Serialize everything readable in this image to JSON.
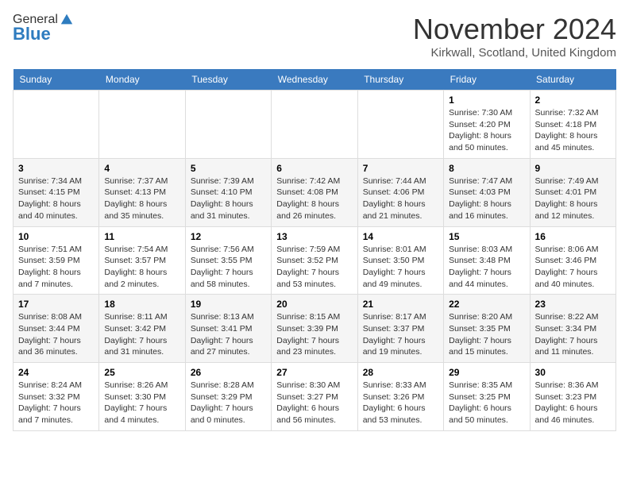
{
  "header": {
    "logo_general": "General",
    "logo_blue": "Blue",
    "month_title": "November 2024",
    "location": "Kirkwall, Scotland, United Kingdom"
  },
  "days_of_week": [
    "Sunday",
    "Monday",
    "Tuesday",
    "Wednesday",
    "Thursday",
    "Friday",
    "Saturday"
  ],
  "weeks": [
    [
      {
        "day": "",
        "info": ""
      },
      {
        "day": "",
        "info": ""
      },
      {
        "day": "",
        "info": ""
      },
      {
        "day": "",
        "info": ""
      },
      {
        "day": "",
        "info": ""
      },
      {
        "day": "1",
        "info": "Sunrise: 7:30 AM\nSunset: 4:20 PM\nDaylight: 8 hours and 50 minutes."
      },
      {
        "day": "2",
        "info": "Sunrise: 7:32 AM\nSunset: 4:18 PM\nDaylight: 8 hours and 45 minutes."
      }
    ],
    [
      {
        "day": "3",
        "info": "Sunrise: 7:34 AM\nSunset: 4:15 PM\nDaylight: 8 hours and 40 minutes."
      },
      {
        "day": "4",
        "info": "Sunrise: 7:37 AM\nSunset: 4:13 PM\nDaylight: 8 hours and 35 minutes."
      },
      {
        "day": "5",
        "info": "Sunrise: 7:39 AM\nSunset: 4:10 PM\nDaylight: 8 hours and 31 minutes."
      },
      {
        "day": "6",
        "info": "Sunrise: 7:42 AM\nSunset: 4:08 PM\nDaylight: 8 hours and 26 minutes."
      },
      {
        "day": "7",
        "info": "Sunrise: 7:44 AM\nSunset: 4:06 PM\nDaylight: 8 hours and 21 minutes."
      },
      {
        "day": "8",
        "info": "Sunrise: 7:47 AM\nSunset: 4:03 PM\nDaylight: 8 hours and 16 minutes."
      },
      {
        "day": "9",
        "info": "Sunrise: 7:49 AM\nSunset: 4:01 PM\nDaylight: 8 hours and 12 minutes."
      }
    ],
    [
      {
        "day": "10",
        "info": "Sunrise: 7:51 AM\nSunset: 3:59 PM\nDaylight: 8 hours and 7 minutes."
      },
      {
        "day": "11",
        "info": "Sunrise: 7:54 AM\nSunset: 3:57 PM\nDaylight: 8 hours and 2 minutes."
      },
      {
        "day": "12",
        "info": "Sunrise: 7:56 AM\nSunset: 3:55 PM\nDaylight: 7 hours and 58 minutes."
      },
      {
        "day": "13",
        "info": "Sunrise: 7:59 AM\nSunset: 3:52 PM\nDaylight: 7 hours and 53 minutes."
      },
      {
        "day": "14",
        "info": "Sunrise: 8:01 AM\nSunset: 3:50 PM\nDaylight: 7 hours and 49 minutes."
      },
      {
        "day": "15",
        "info": "Sunrise: 8:03 AM\nSunset: 3:48 PM\nDaylight: 7 hours and 44 minutes."
      },
      {
        "day": "16",
        "info": "Sunrise: 8:06 AM\nSunset: 3:46 PM\nDaylight: 7 hours and 40 minutes."
      }
    ],
    [
      {
        "day": "17",
        "info": "Sunrise: 8:08 AM\nSunset: 3:44 PM\nDaylight: 7 hours and 36 minutes."
      },
      {
        "day": "18",
        "info": "Sunrise: 8:11 AM\nSunset: 3:42 PM\nDaylight: 7 hours and 31 minutes."
      },
      {
        "day": "19",
        "info": "Sunrise: 8:13 AM\nSunset: 3:41 PM\nDaylight: 7 hours and 27 minutes."
      },
      {
        "day": "20",
        "info": "Sunrise: 8:15 AM\nSunset: 3:39 PM\nDaylight: 7 hours and 23 minutes."
      },
      {
        "day": "21",
        "info": "Sunrise: 8:17 AM\nSunset: 3:37 PM\nDaylight: 7 hours and 19 minutes."
      },
      {
        "day": "22",
        "info": "Sunrise: 8:20 AM\nSunset: 3:35 PM\nDaylight: 7 hours and 15 minutes."
      },
      {
        "day": "23",
        "info": "Sunrise: 8:22 AM\nSunset: 3:34 PM\nDaylight: 7 hours and 11 minutes."
      }
    ],
    [
      {
        "day": "24",
        "info": "Sunrise: 8:24 AM\nSunset: 3:32 PM\nDaylight: 7 hours and 7 minutes."
      },
      {
        "day": "25",
        "info": "Sunrise: 8:26 AM\nSunset: 3:30 PM\nDaylight: 7 hours and 4 minutes."
      },
      {
        "day": "26",
        "info": "Sunrise: 8:28 AM\nSunset: 3:29 PM\nDaylight: 7 hours and 0 minutes."
      },
      {
        "day": "27",
        "info": "Sunrise: 8:30 AM\nSunset: 3:27 PM\nDaylight: 6 hours and 56 minutes."
      },
      {
        "day": "28",
        "info": "Sunrise: 8:33 AM\nSunset: 3:26 PM\nDaylight: 6 hours and 53 minutes."
      },
      {
        "day": "29",
        "info": "Sunrise: 8:35 AM\nSunset: 3:25 PM\nDaylight: 6 hours and 50 minutes."
      },
      {
        "day": "30",
        "info": "Sunrise: 8:36 AM\nSunset: 3:23 PM\nDaylight: 6 hours and 46 minutes."
      }
    ]
  ]
}
